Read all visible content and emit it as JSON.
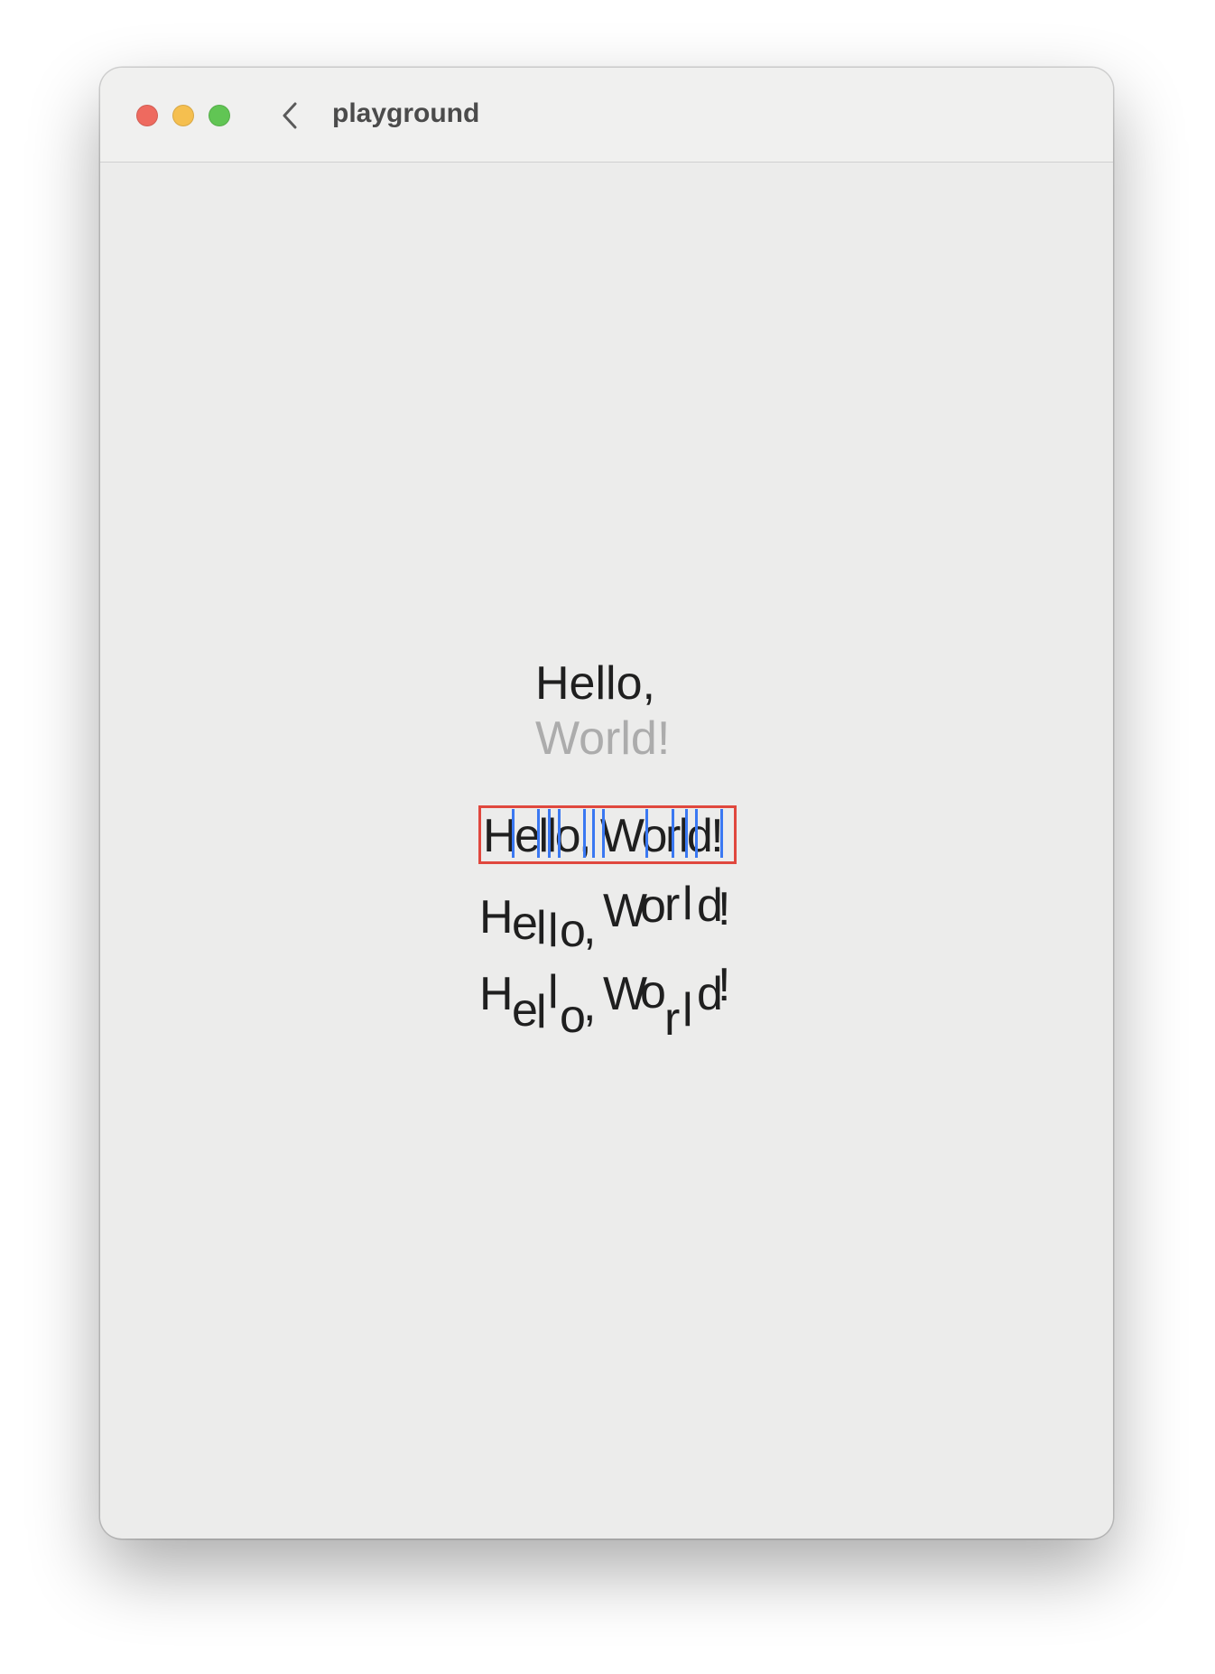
{
  "window": {
    "title": "playground"
  },
  "titlebar": {
    "traffic_lights": [
      "close",
      "minimize",
      "zoom"
    ],
    "back_icon": "chevron-left-icon"
  },
  "content": {
    "line1": "Hello,",
    "line2": "World!",
    "boxed_text": "Hello, World!",
    "wave_text": "Hello, World!",
    "wave2_text": "Hello, World!"
  },
  "colors": {
    "selection_box": "#e0483e",
    "glyph_markers": "#3a78f2",
    "muted_text": "#acacac",
    "text": "#1f1f1f"
  }
}
